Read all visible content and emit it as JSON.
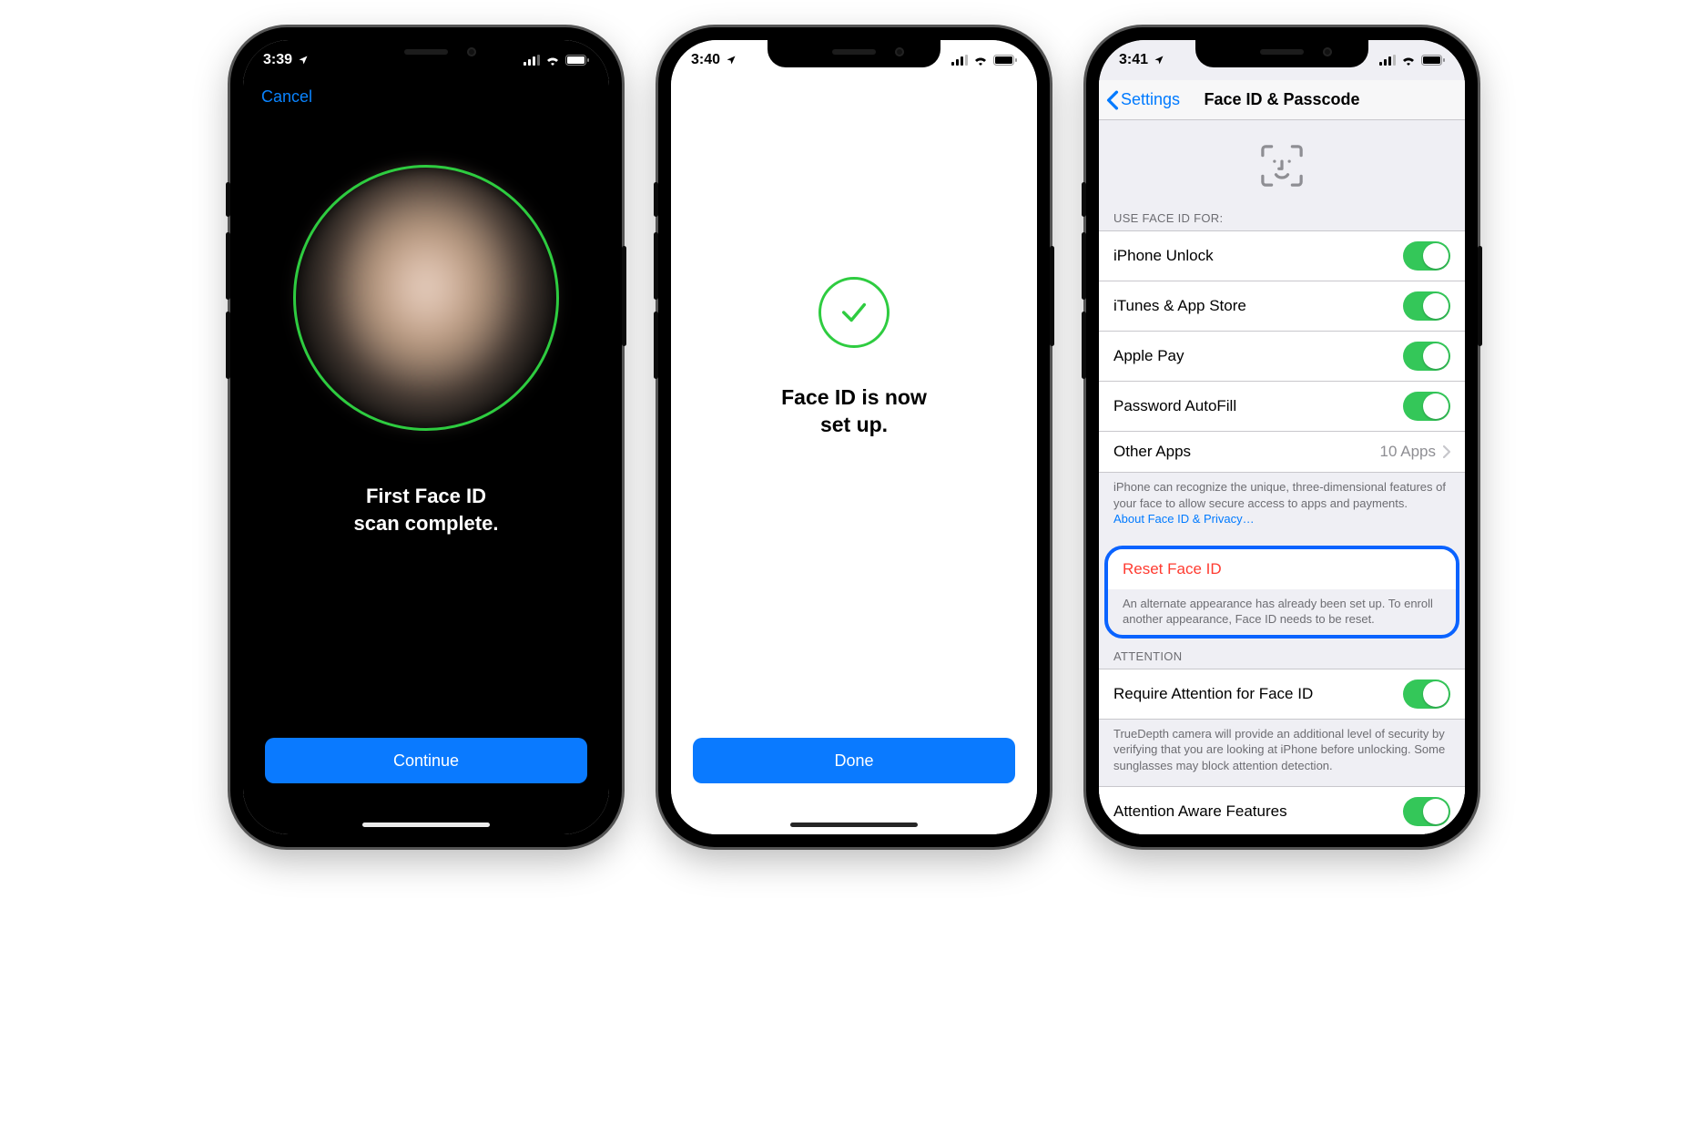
{
  "screen1": {
    "time": "3:39",
    "cancel": "Cancel",
    "message_l1": "First Face ID",
    "message_l2": "scan complete.",
    "cta": "Continue"
  },
  "screen2": {
    "time": "3:40",
    "message_l1": "Face ID is now",
    "message_l2": "set up.",
    "cta": "Done"
  },
  "screen3": {
    "time": "3:41",
    "back": "Settings",
    "title": "Face ID & Passcode",
    "section_use_header": "USE FACE ID FOR:",
    "rows": {
      "unlock": "iPhone Unlock",
      "itunes": "iTunes & App Store",
      "applepay": "Apple Pay",
      "autofill": "Password AutoFill",
      "otherapps": "Other Apps",
      "otherapps_count": "10 Apps"
    },
    "use_footer": "iPhone can recognize the unique, three-dimensional features of your face to allow secure access to apps and payments.",
    "use_footer_link": "About Face ID & Privacy…",
    "reset_label": "Reset Face ID",
    "reset_footer": "An alternate appearance has already been set up. To enroll another appearance, Face ID needs to be reset.",
    "attention_header": "ATTENTION",
    "attention_row": "Require Attention for Face ID",
    "attention_footer": "TrueDepth camera will provide an additional level of security by verifying that you are looking at iPhone before unlocking. Some sunglasses may block attention detection.",
    "aware_row": "Attention Aware Features"
  }
}
